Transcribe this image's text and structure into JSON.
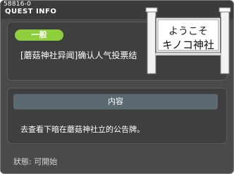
{
  "window": {
    "quest_id": "58816-0",
    "title": "QUEST INFO"
  },
  "quest": {
    "category": "一般",
    "name": "[蘑菇神社异闻]确认人气投票结"
  },
  "content": {
    "header": "内容",
    "text": "去查看下暗在蘑菇神社立的公告牌。"
  },
  "status": {
    "text": "狀態: 可開始"
  },
  "sign": {
    "line1": "ようこそ",
    "line2": "キノコ神社"
  },
  "colors": {
    "window_bg": "#4a4a4a",
    "category_pill": "#8fcf3e",
    "content_header": "#5a6a70"
  }
}
